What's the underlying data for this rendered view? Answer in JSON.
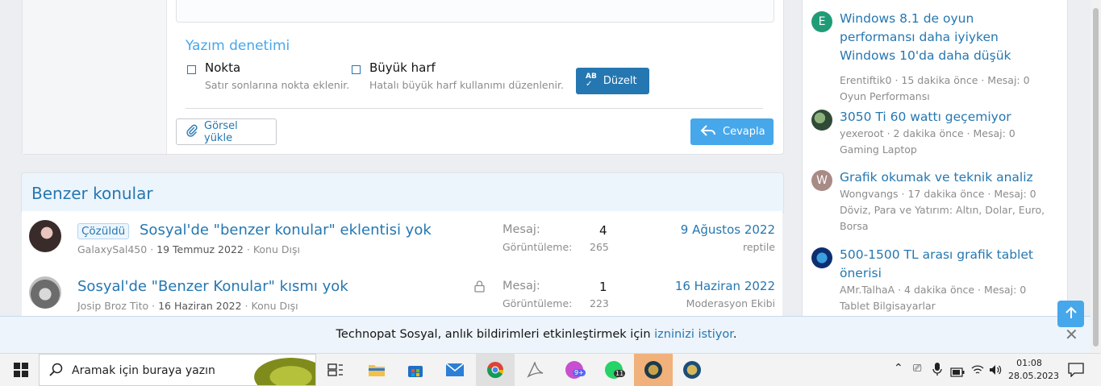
{
  "spellcheck": {
    "title": "Yazım denetimi",
    "options": [
      {
        "label": "Nokta",
        "desc": "Satır sonlarına nokta eklenir."
      },
      {
        "label": "Büyük harf",
        "desc": "Hatalı büyük harf kullanımı düzenlenir."
      }
    ],
    "fix_button": "Düzelt",
    "fix_icon_text": "AB"
  },
  "editor": {
    "upload_button": "Görsel yükle",
    "reply_button": "Cevapla"
  },
  "similar": {
    "heading": "Benzer konular",
    "threads": [
      {
        "badge": "Çözüldü",
        "title": "Sosyal'de \"benzer konular\" eklentisi yok",
        "author": "GalaxySal450",
        "date": "19 Temmuz 2022",
        "forum": "Konu Dışı",
        "replies_label": "Mesaj:",
        "replies": "4",
        "views_label": "Görüntüleme:",
        "views": "265",
        "last_date": "9 Ağustos 2022",
        "last_user": "reptile"
      },
      {
        "title": "Sosyal'de \"Benzer Konular\" kısmı yok",
        "author": "Josip Broz Tito",
        "date": "16 Haziran 2022",
        "forum": "Konu Dışı",
        "replies_label": "Mesaj:",
        "replies": "1",
        "views_label": "Görüntüleme:",
        "views": "223",
        "last_date": "16 Haziran 2022",
        "last_user": "Moderasyon Ekibi"
      }
    ],
    "separator": "·"
  },
  "sidebar": {
    "items": [
      {
        "avatar_letter": "E",
        "avatar_color": "#1f9c76",
        "title": "Windows 8.1 de oyun performansı daha iyiyken Windows 10'da daha düşük",
        "meta": "Erentiftik0 · 15 dakika önce · Mesaj: 0",
        "forum": "Oyun Performansı"
      },
      {
        "avatar_letter": "",
        "avatar_color": "#4a6b52",
        "title": "3050 Ti 60 wattı geçemiyor",
        "meta": "yexeroot · 2 dakika önce · Mesaj: 0",
        "forum": "Gaming Laptop"
      },
      {
        "avatar_letter": "W",
        "avatar_color": "#a88b86",
        "title": "Grafik okumak ve teknik analiz",
        "meta": "Wongvangs · 17 dakika önce · Mesaj: 0",
        "forum": "Döviz, Para ve Yatırım: Altın, Dolar, Euro, Borsa"
      },
      {
        "avatar_letter": "",
        "avatar_color": "#1b4fa0",
        "title": "500-1500 TL arası grafik tablet önerisi",
        "meta": "AMr.TalhaA · 4 dakika önce · Mesaj: 0",
        "forum": "Tablet Bilgisayarlar"
      }
    ]
  },
  "notification": {
    "text": "Technopat Sosyal, anlık bildirimleri etkinleştirmek için ",
    "link": "izninizi istiyor",
    "end": "."
  },
  "taskbar": {
    "search_placeholder": "Aramak için buraya yazın",
    "time": "01:08",
    "date": "28.05.2023",
    "discord_badge": "9+",
    "whatsapp_badge": "11"
  },
  "colors": {
    "accent": "#2577b1",
    "reply_button": "#47a7eb",
    "fix_button": "#2577b1"
  }
}
